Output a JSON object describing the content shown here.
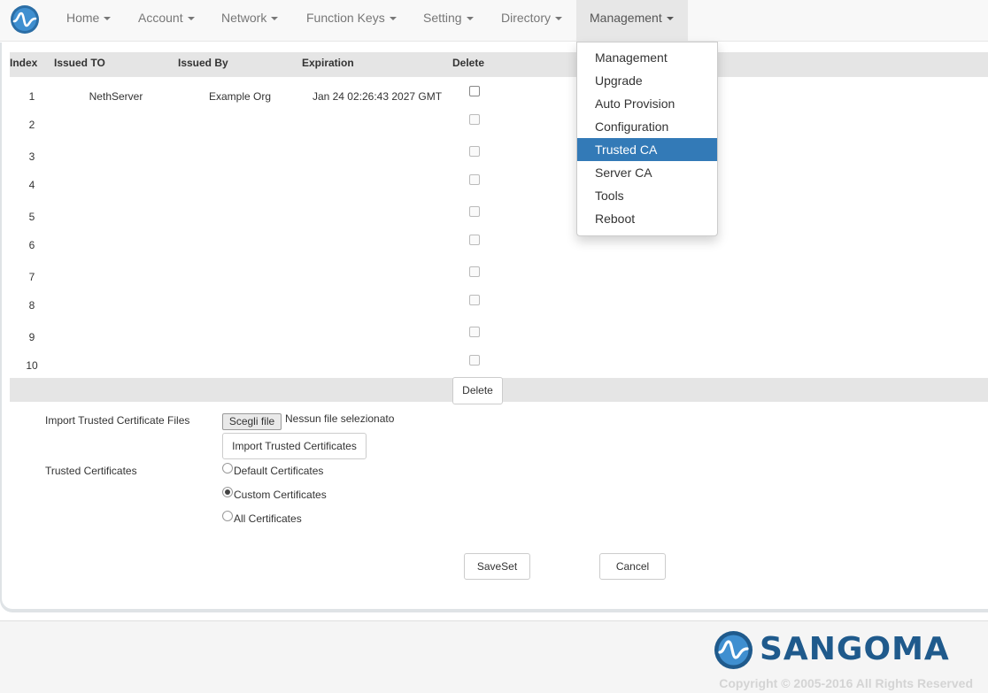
{
  "nav": {
    "items": [
      {
        "label": "Home"
      },
      {
        "label": "Account"
      },
      {
        "label": "Network"
      },
      {
        "label": "Function Keys"
      },
      {
        "label": "Setting"
      },
      {
        "label": "Directory"
      },
      {
        "label": "Management"
      }
    ],
    "active": "Management"
  },
  "dropdown": {
    "items": [
      {
        "label": "Management"
      },
      {
        "label": "Upgrade"
      },
      {
        "label": "Auto Provision"
      },
      {
        "label": "Configuration"
      },
      {
        "label": "Trusted CA"
      },
      {
        "label": "Server CA"
      },
      {
        "label": "Tools"
      },
      {
        "label": "Reboot"
      }
    ],
    "active": "Trusted CA"
  },
  "table": {
    "headers": {
      "index": "Index",
      "issued_to": "Issued TO",
      "issued_by": "Issued By",
      "expiration": "Expiration",
      "delete": "Delete"
    },
    "rows": [
      {
        "index": "1",
        "issued_to": "NethServer",
        "issued_by": "Example Org",
        "expiration": "Jan 24 02:26:43 2027 GMT",
        "checkbox_enabled": true
      },
      {
        "index": "2",
        "issued_to": "",
        "issued_by": "",
        "expiration": "",
        "checkbox_enabled": false
      },
      {
        "index": "3",
        "issued_to": "",
        "issued_by": "",
        "expiration": "",
        "checkbox_enabled": false
      },
      {
        "index": "4",
        "issued_to": "",
        "issued_by": "",
        "expiration": "",
        "checkbox_enabled": false
      },
      {
        "index": "5",
        "issued_to": "",
        "issued_by": "",
        "expiration": "",
        "checkbox_enabled": false
      },
      {
        "index": "6",
        "issued_to": "",
        "issued_by": "",
        "expiration": "",
        "checkbox_enabled": false
      },
      {
        "index": "7",
        "issued_to": "",
        "issued_by": "",
        "expiration": "",
        "checkbox_enabled": false
      },
      {
        "index": "8",
        "issued_to": "",
        "issued_by": "",
        "expiration": "",
        "checkbox_enabled": false
      },
      {
        "index": "9",
        "issued_to": "",
        "issued_by": "",
        "expiration": "",
        "checkbox_enabled": false
      },
      {
        "index": "10",
        "issued_to": "",
        "issued_by": "",
        "expiration": "",
        "checkbox_enabled": false
      }
    ],
    "delete_label": "Delete"
  },
  "import": {
    "label": "Import Trusted Certificate Files",
    "choose_label": "Scegli file",
    "no_file_label": "Nessun file selezionato",
    "import_button": "Import Trusted Certificates"
  },
  "trusted": {
    "label": "Trusted Certificates",
    "options": [
      {
        "label": "Default Certificates",
        "checked": false
      },
      {
        "label": "Custom Certificates",
        "checked": true
      },
      {
        "label": "All Certificates",
        "checked": false
      }
    ]
  },
  "actions": {
    "save": "SaveSet",
    "cancel": "Cancel"
  },
  "footer": {
    "brand": "SANGOMA",
    "copyright": "Copyright © 2005-2016 All Rights Reserved"
  },
  "colors": {
    "accent": "#337ab7",
    "brand": "#1f5a8c"
  }
}
